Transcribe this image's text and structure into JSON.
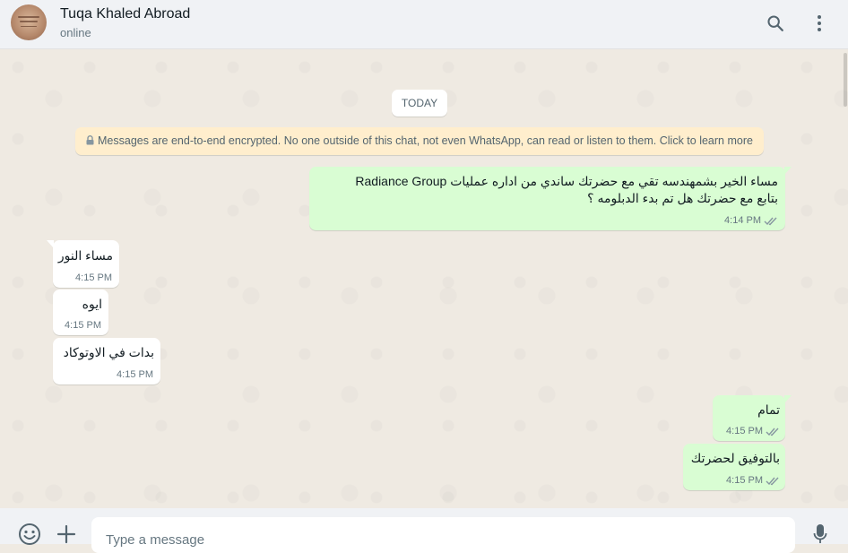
{
  "header": {
    "contact_name": "Tuqa Khaled Abroad",
    "status": "online",
    "avatar_icon": "profile-photo",
    "search_icon": "search-icon",
    "menu_icon": "menu-dots-icon"
  },
  "chat": {
    "date_label": "TODAY",
    "encryption_notice": "Messages are end-to-end encrypted. No one outside of this chat, not even WhatsApp, can read or listen to them. Click to learn more",
    "messages": [
      {
        "direction": "outgoing",
        "line1": "مساء الخير بشمهندسه تقي مع حضرتك ساندي من اداره عمليات Radiance Group",
        "line2": "بتابع مع حضرتك هل تم بدء الدبلومه ؟",
        "time": "4:14 PM",
        "status": "read"
      },
      {
        "direction": "incoming",
        "text": "مساء النور",
        "time": "4:15 PM"
      },
      {
        "direction": "incoming",
        "text": "ايوه",
        "time": "4:15 PM"
      },
      {
        "direction": "incoming",
        "text": "بدات في الاوتوكاد",
        "time": "4:15 PM"
      },
      {
        "direction": "outgoing",
        "text": "تمام",
        "time": "4:15 PM",
        "status": "read"
      },
      {
        "direction": "outgoing",
        "text": "بالتوفيق لحضرتك",
        "time": "4:15 PM",
        "status": "read"
      }
    ]
  },
  "footer": {
    "input_placeholder": "Type a message",
    "emoji_icon": "emoji-icon",
    "attach_icon": "plus-icon",
    "mic_icon": "microphone-icon"
  },
  "colors": {
    "outgoing_bubble": "#d9fdd3",
    "incoming_bubble": "#ffffff",
    "chat_background": "#efeae2",
    "header_background": "#f0f2f5",
    "read_ticks": "#8696a0",
    "notice_background": "#ffeecd"
  }
}
